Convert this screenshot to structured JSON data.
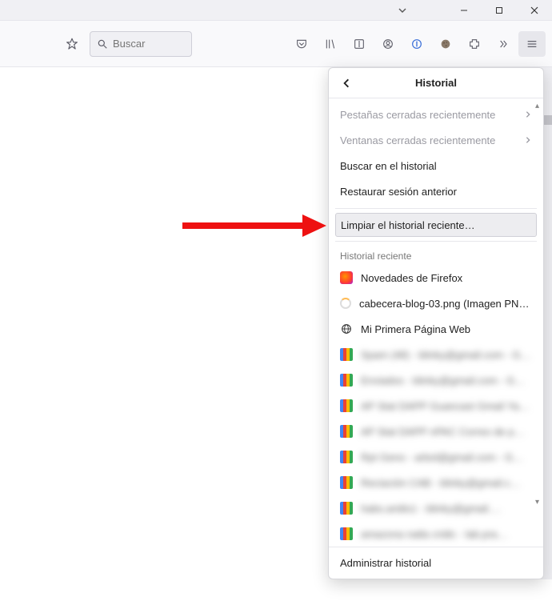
{
  "search": {
    "placeholder": "Buscar"
  },
  "panel": {
    "title": "Historial",
    "recent_tabs": "Pestañas cerradas recientemente",
    "recent_windows": "Ventanas cerradas recientemente",
    "search_history": "Buscar en el historial",
    "restore_session": "Restaurar sesión anterior",
    "clear_history": "Limpiar el historial reciente…",
    "section_label": "Historial reciente",
    "items": [
      {
        "label": "Novedades de Firefox",
        "fav": "ff"
      },
      {
        "label": "cabecera-blog-03.png (Imagen PN…",
        "fav": "spin"
      },
      {
        "label": "Mi Primera Página Web",
        "fav": "globe"
      }
    ],
    "blurred": [
      "Spam (48) - blinky@gmail.com - G…",
      "Enviados - blinky@gmail.com - G…",
      "AP Stat DAPP Guancast Gmail Ya…",
      "AP Stat DAPP nPAC Correo de p…",
      "Rpt Geno - arbol@gmail.com - G…",
      "Reciación CAB - blinky@gmail.c…",
      "habs.aridis1 - blinky@gmail.…",
      "amazona natla cridic - lab.pra…"
    ],
    "manage": "Administrar historial"
  }
}
